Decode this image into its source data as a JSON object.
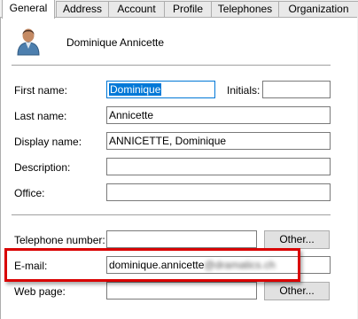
{
  "tabs": [
    "General",
    "Address",
    "Account",
    "Profile",
    "Telephones",
    "Organization"
  ],
  "header": {
    "user_name": "Dominique Annicette"
  },
  "labels": {
    "first_name": "First name:",
    "initials": "Initials:",
    "last_name": "Last name:",
    "display_name": "Display name:",
    "description": "Description:",
    "office": "Office:",
    "telephone": "Telephone number:",
    "email": "E-mail:",
    "web_page": "Web page:"
  },
  "values": {
    "first_name": "Dominique",
    "initials": "",
    "last_name": "Annicette",
    "display_name": "ANNICETTE, Dominique",
    "description": "",
    "office": "",
    "telephone": "",
    "email_visible": "dominique.annicette",
    "email_obscured": "@dramatics.ch",
    "web_page": ""
  },
  "buttons": {
    "telephone_other": "Other...",
    "web_other": "Other..."
  },
  "colors": {
    "highlight": "#d90000",
    "selection": "#0078d7"
  },
  "icons": {
    "user": "user-silhouette-icon"
  }
}
